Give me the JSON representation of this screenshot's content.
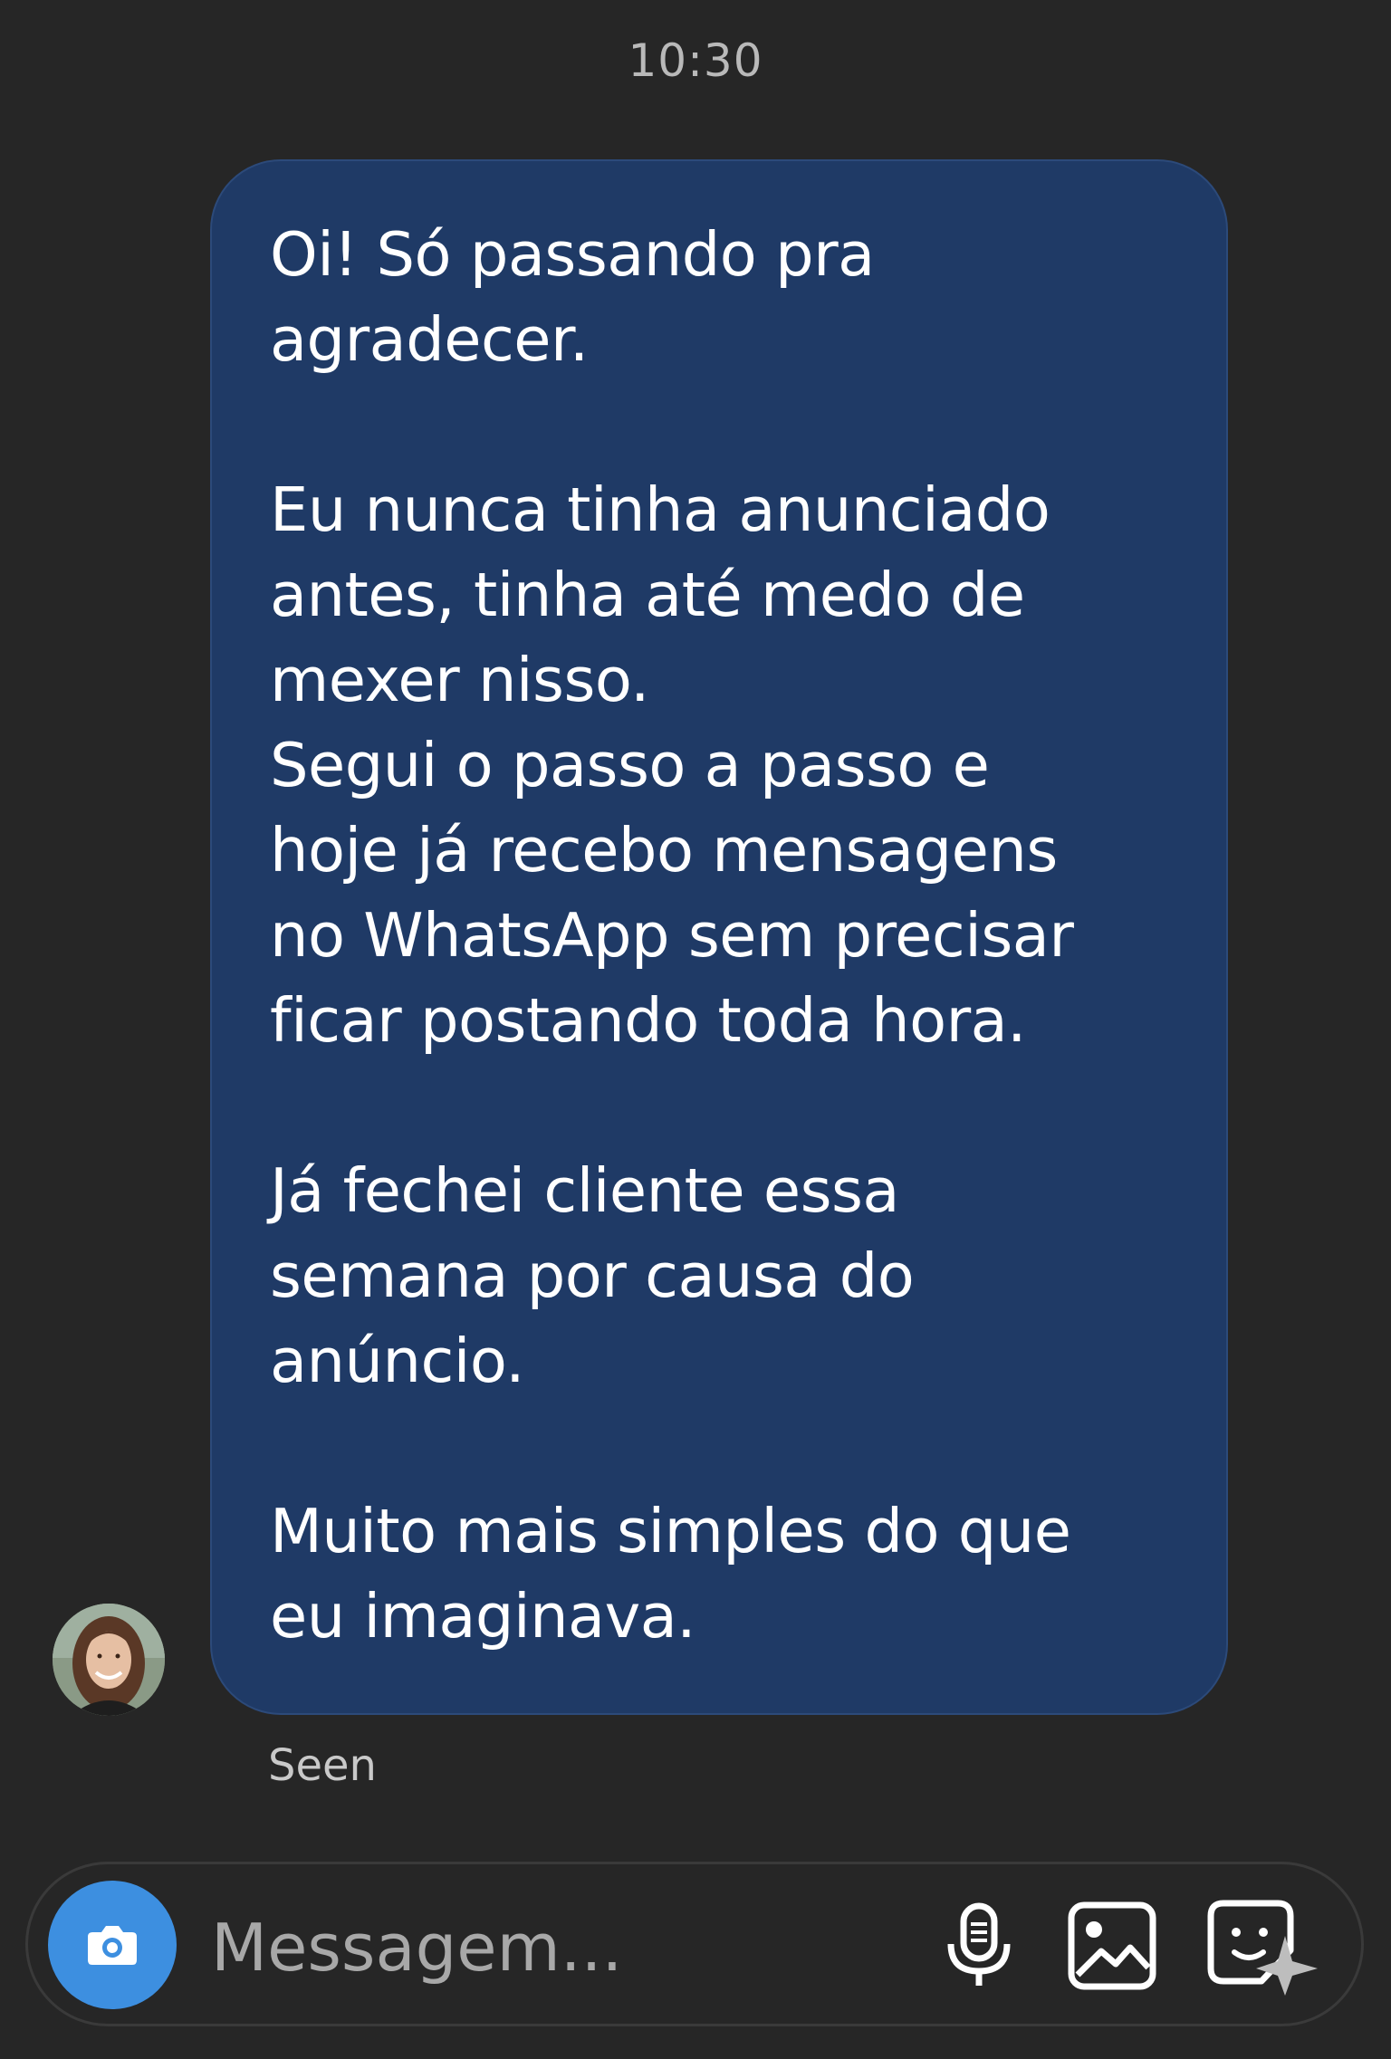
{
  "status_time": "10:30",
  "message": {
    "paragraphs": [
      "Oi! Só passando pra\nagradecer.",
      "Eu nunca tinha anunciado\nantes, tinha até medo de\nmexer nisso.\nSegui o passo a passo e\nhoje já recebo mensagens\nno WhatsApp sem precisar\nficar postando toda hora.",
      "Já fechei cliente essa\nsemana por causa do\nanúncio.",
      "Muito mais simples do que\neu imaginava."
    ],
    "status": "Seen",
    "bubble_color": "#1f3a66"
  },
  "composer": {
    "placeholder": "Messagem...",
    "camera_color": "#3d8fe0",
    "icons": [
      "camera-icon",
      "microphone-icon",
      "gallery-icon",
      "sticker-icon"
    ]
  }
}
